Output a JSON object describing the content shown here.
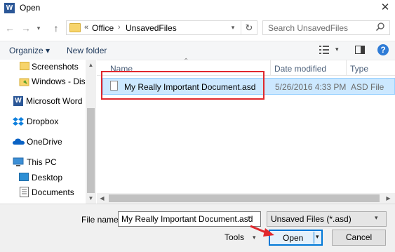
{
  "window": {
    "title": "Open",
    "app_icon_letter": "W",
    "close_glyph": "✕"
  },
  "address": {
    "more_glyph": "«",
    "crumbs": [
      "Office",
      "UnsavedFiles"
    ],
    "separator": "›",
    "search_placeholder": "Search UnsavedFiles"
  },
  "toolbar": {
    "organize_label": "Organize ▾",
    "new_folder_label": "New folder",
    "help_glyph": "?"
  },
  "nav_pane": {
    "items": [
      {
        "label": "Screenshots",
        "icon": "folder-icon"
      },
      {
        "label": "Windows - Disk",
        "icon": "onedrive-folder-icon"
      },
      {
        "label": "Microsoft Word",
        "icon": "word-icon"
      },
      {
        "label": "Dropbox",
        "icon": "dropbox-icon"
      },
      {
        "label": "OneDrive",
        "icon": "onedrive-icon"
      },
      {
        "label": "This PC",
        "icon": "computer-icon"
      },
      {
        "label": "Desktop",
        "icon": "desktop-icon"
      },
      {
        "label": "Documents",
        "icon": "documents-icon"
      }
    ]
  },
  "file_list": {
    "columns": {
      "name": "Name",
      "date": "Date modified",
      "type": "Type"
    },
    "rows": [
      {
        "name": "My Really Important Document.asd",
        "date": "5/26/2016 4:33 PM",
        "type": "ASD File"
      }
    ]
  },
  "bottom": {
    "filename_label": "File name:",
    "filename_value": "My Really Important Document.asd",
    "filetype_value": "Unsaved Files (*.asd)",
    "tools_label": "Tools",
    "open_label": "Open",
    "cancel_label": "Cancel"
  },
  "colors": {
    "selection": "#cce8ff",
    "highlight": "#e0282d",
    "accent": "#0078d7"
  }
}
